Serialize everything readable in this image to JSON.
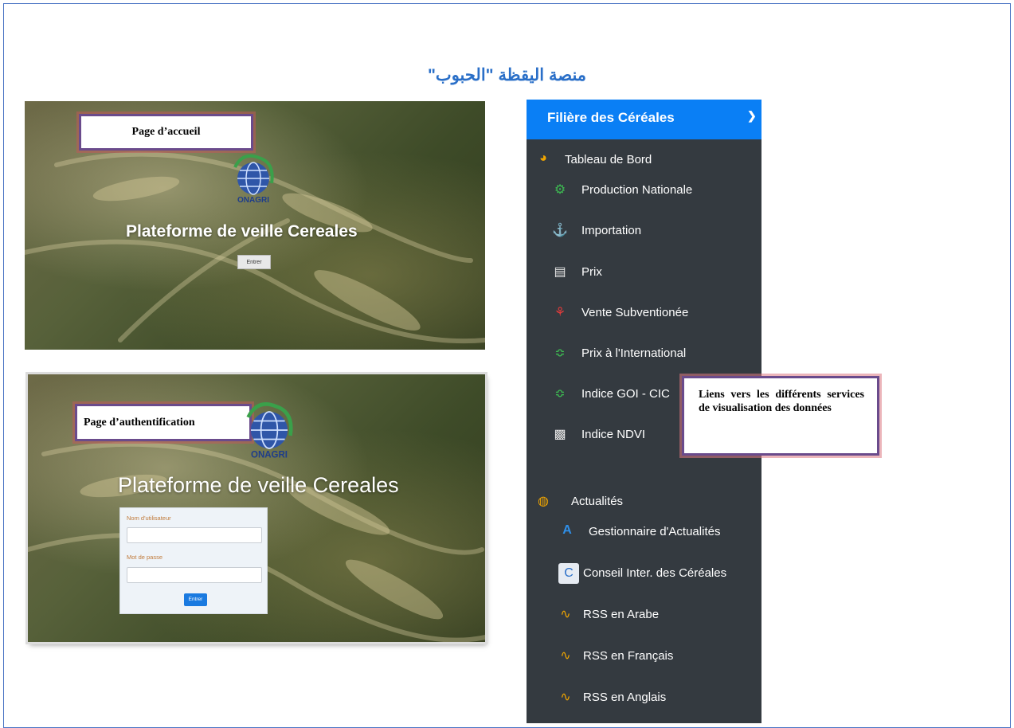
{
  "doc": {
    "title": "منصة اليقظة \"الحبوب\""
  },
  "home": {
    "callout": "Page d’accueil",
    "logo_text": "ONAGRI",
    "platform_title": "Plateforme de veille Cereales",
    "enter_label": "Entrer"
  },
  "auth": {
    "callout": "Page d’authentification",
    "logo_text": "ONAGRI",
    "platform_title": "Plateforme de veille Cereales",
    "username_label": "Nom d'utilisateur",
    "password_label": "Mot de passe",
    "enter_label": "Entrer"
  },
  "sidebar": {
    "header": "Filière des Céréales",
    "sections": [
      {
        "label": "Tableau de Bord",
        "icon": "dashboard-icon",
        "items": [
          {
            "label": "Production Nationale",
            "icon": "tractor-icon"
          },
          {
            "label": "Importation",
            "icon": "anchor-icon"
          },
          {
            "label": "Prix",
            "icon": "price-tag-icon"
          },
          {
            "label": "Vente Subventionée",
            "icon": "cart-icon"
          },
          {
            "label": "Prix à l'International",
            "icon": "area-chart-icon"
          },
          {
            "label": "Indice GOI - CIC",
            "icon": "area-chart-icon"
          },
          {
            "label": "Indice NDVI",
            "icon": "bar-chart-icon"
          }
        ]
      },
      {
        "label": "Actualités",
        "icon": "globe-icon",
        "items": [
          {
            "label": "Gestionnaire d'Actualités",
            "icon": "broadcast-icon"
          },
          {
            "label": "Conseil Inter. des Céréales",
            "icon": "igc-logo-icon"
          },
          {
            "label": "RSS en Arabe",
            "icon": "rss-icon"
          },
          {
            "label": "RSS en Français",
            "icon": "rss-icon"
          },
          {
            "label": "RSS en Anglais",
            "icon": "rss-icon"
          }
        ]
      }
    ]
  },
  "links_callout": "Liens vers les différents services de visualisation des données",
  "colors": {
    "accent": "#0a7ff5",
    "sidebar_bg": "#343a40",
    "title": "#2a6fc8",
    "rss": "#f0a500"
  }
}
